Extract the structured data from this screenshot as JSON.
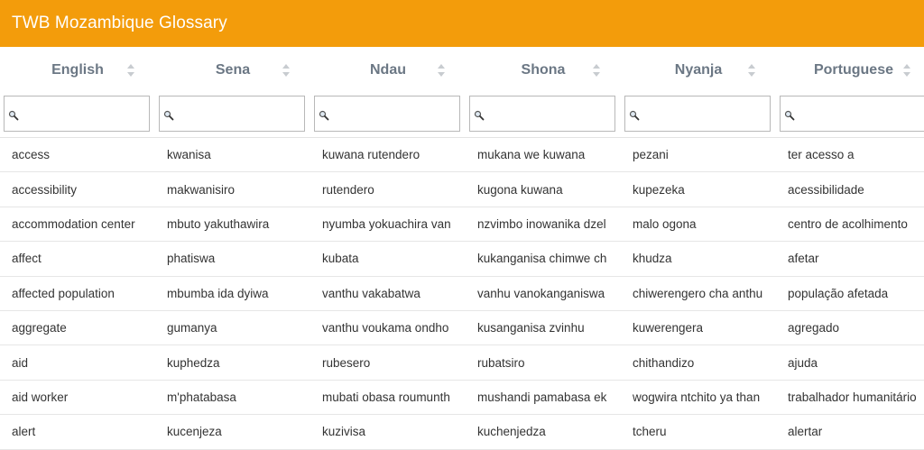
{
  "app": {
    "title": "TWB Mozambique Glossary",
    "accent_color": "#f39c0b"
  },
  "columns": [
    {
      "label": "English"
    },
    {
      "label": "Sena"
    },
    {
      "label": "Ndau"
    },
    {
      "label": "Shona"
    },
    {
      "label": "Nyanja"
    },
    {
      "label": "Portuguese"
    }
  ],
  "rows": [
    [
      "access",
      "kwanisa",
      "kuwana rutendero",
      "mukana we kuwana",
      "pezani",
      "ter acesso a"
    ],
    [
      "accessibility",
      "makwanisiro",
      "rutendero",
      "kugona kuwana",
      "kupezeka",
      "acessibilidade"
    ],
    [
      "accommodation center",
      "mbuto yakuthawira",
      "nyumba yokuachira van",
      "nzvimbo inowanika dzel",
      "malo ogona",
      "centro de acolhimento"
    ],
    [
      "affect",
      "phatiswa",
      "kubata",
      "kukanganisa chimwe ch",
      "khudza",
      "afetar"
    ],
    [
      "affected population",
      "mbumba ida dyiwa",
      "vanthu vakabatwa",
      "vanhu vanokanganiswa",
      "chiwerengero cha anthu",
      "população afetada"
    ],
    [
      "aggregate",
      "gumanya",
      "vanthu voukama ondho",
      "kusanganisa zvinhu",
      "kuwerengera",
      "agregado"
    ],
    [
      "aid",
      "kuphedza",
      "rubesero",
      "rubatsiro",
      "chithandizo",
      "ajuda"
    ],
    [
      "aid worker",
      "m'phatabasa",
      "mubati obasa roumunth",
      "mushandi pamabasa ek",
      "wogwira ntchito ya than",
      "trabalhador humanitário"
    ],
    [
      "alert",
      "kucenjeza",
      "kuzivisa",
      "kuchenjedza",
      "tcheru",
      "alertar"
    ]
  ]
}
